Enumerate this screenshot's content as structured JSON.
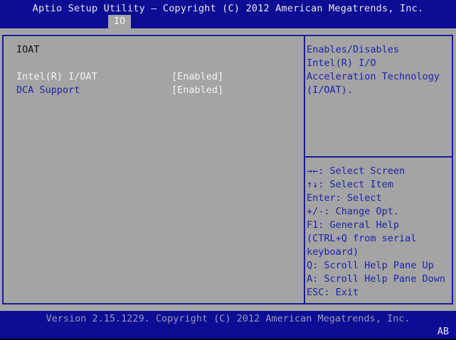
{
  "header": {
    "title": "Aptio Setup Utility – Copyright (C) 2012 American Megatrends, Inc.",
    "tabs": [
      {
        "label": "IO",
        "active": true
      }
    ]
  },
  "main": {
    "section_title": "IOAT",
    "settings": [
      {
        "label": "Intel(R) I/OAT",
        "value": "[Enabled]",
        "selected": true
      },
      {
        "label": "DCA Support",
        "value": "[Enabled]",
        "selected": false
      }
    ]
  },
  "help": {
    "description": [
      "Enables/Disables",
      "Intel(R) I/O",
      "Acceleration Technology",
      "(I/OAT)."
    ]
  },
  "keys": [
    "→←: Select Screen",
    "↑↓: Select Item",
    "Enter: Select",
    "+/-: Change Opt.",
    "F1: General Help",
    "(CTRL+Q from serial",
    "keyboard)",
    "Q: Scroll Help Pane Up",
    "A: Scroll Help Pane Down",
    "ESC: Exit"
  ],
  "footer": {
    "version": "Version 2.15.1229. Copyright (C) 2012 American Megatrends, Inc.",
    "code": "AB"
  },
  "colors": {
    "blue": "#0c0c94",
    "gray": "#a4a4a4",
    "text_blue": "#1e22a8"
  }
}
